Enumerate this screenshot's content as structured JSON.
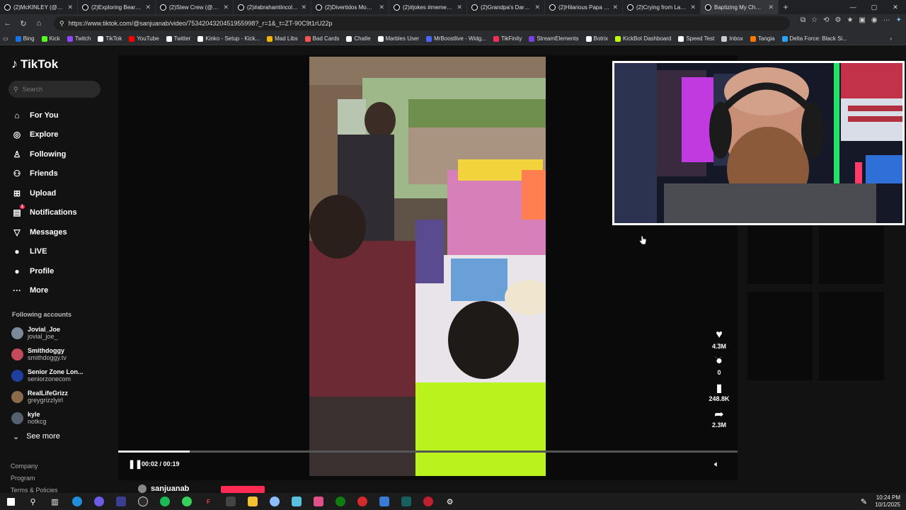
{
  "browser": {
    "tabs": [
      {
        "title": "(2)McKINLEY (@mcki…"
      },
      {
        "title": "(2)Exploring Bear Beh…"
      },
      {
        "title": "(2)Stew Crew (@nsbb…"
      },
      {
        "title": "(2)#abrahamlincoln #…"
      },
      {
        "title": "(2)Divertidos Moment…"
      },
      {
        "title": "(2)#jokes #memes #…"
      },
      {
        "title": "(2)Grandpa's Dark Hu…"
      },
      {
        "title": "(2)Hilarious Papa Surv…"
      },
      {
        "title": "(2)Crying from Laugh…"
      },
      {
        "title": "Baptizing My Ch…"
      }
    ],
    "url": "https://www.tiktok.com/@sanjuanab/video/7534204320451955998?_r=1&_t=ZT-90C9t1rU22p",
    "bookmarks": [
      "Bing",
      "Kick",
      "Twitch",
      "TikTok",
      "YouTube",
      "Twitter",
      "Kinko - Setup - Kick...",
      "Mad Libs",
      "Bad Cards",
      "Chatle",
      "Marbles User",
      "MrBoostlive - Widg...",
      "TikFinity",
      "StreamElements",
      "Botrix",
      "KickBot Dashboard",
      "Speed Test",
      "Inbox",
      "Tangia",
      "Delta Force: Black Si..."
    ],
    "bookmark_colors": [
      "#1a73e8",
      "#53fc18",
      "#9146ff",
      "#ffffff",
      "#ff0000",
      "#ffffff",
      "#ffffff",
      "#f4b400",
      "#ff5252",
      "#ffffff",
      "#ffffff",
      "#4a66ff",
      "#fe2c55",
      "#7b3fe4",
      "#ffffff",
      "#c0ff00",
      "#ffffff",
      "#cccccc",
      "#ff7a00",
      "#29a3ff"
    ]
  },
  "tiktok": {
    "brand": "TikTok",
    "search_placeholder": "Search",
    "nav": [
      {
        "label": "For You",
        "icon": "home-icon",
        "glyph": "⌂"
      },
      {
        "label": "Explore",
        "icon": "compass-icon",
        "glyph": "◎"
      },
      {
        "label": "Following",
        "icon": "user-follow-icon",
        "glyph": "♙"
      },
      {
        "label": "Friends",
        "icon": "friends-icon",
        "glyph": "⚇"
      },
      {
        "label": "Upload",
        "icon": "upload-icon",
        "glyph": "⊞"
      },
      {
        "label": "Notifications",
        "icon": "notification-icon",
        "glyph": "▤"
      },
      {
        "label": "Messages",
        "icon": "messages-icon",
        "glyph": "▽"
      },
      {
        "label": "LIVE",
        "icon": "live-icon",
        "glyph": "●"
      },
      {
        "label": "Profile",
        "icon": "profile-icon",
        "glyph": "●"
      },
      {
        "label": "More",
        "icon": "more-icon",
        "glyph": "···"
      }
    ],
    "notification_badge": "1",
    "following_title": "Following accounts",
    "following": [
      {
        "name": "Jovial_Joe",
        "handle": "jovial_joe_",
        "color": "#7a8a9a"
      },
      {
        "name": "Smithdoggy",
        "handle": "smithdoggy.tv",
        "color": "#c24a5a"
      },
      {
        "name": "Senior Zone Lon...",
        "handle": "seniorzonecom",
        "color": "#1f3fa0"
      },
      {
        "name": "RealLifeGrizz",
        "handle": "greygrizzlyirl",
        "color": "#8b6b4a"
      },
      {
        "name": "kyle",
        "handle": "notkcg",
        "color": "#556070"
      }
    ],
    "see_more": "See more",
    "footer": [
      "Company",
      "Program",
      "Terms & Policies"
    ],
    "video": {
      "time": "00:02 / 00:19",
      "progress": 0.115,
      "uploader": "sanjuanab"
    },
    "actions": [
      {
        "icon": "heart-icon",
        "glyph": "♥",
        "count": "4.3M"
      },
      {
        "icon": "comment-icon",
        "glyph": "●",
        "count": "0"
      },
      {
        "icon": "bookmark-icon",
        "glyph": "▮",
        "count": "248.8K"
      },
      {
        "icon": "share-icon",
        "glyph": "➦",
        "count": "2.3M"
      }
    ]
  },
  "taskbar": {
    "time": "10:24 PM",
    "date": "10/1/2025"
  }
}
